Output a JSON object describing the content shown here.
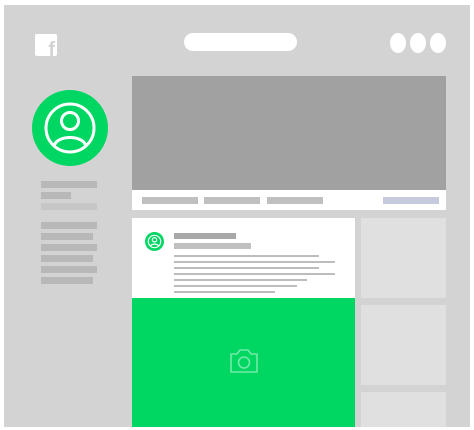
{
  "colors": {
    "frame": "#d3d3d3",
    "accent": "#00d762",
    "cover": "#a1a1a1",
    "placeholder": "#b8b8b8",
    "tile": "#e0e0e0"
  },
  "icons": {
    "brand": "facebook-icon",
    "window_controls": [
      "dot-icon",
      "dot-icon",
      "dot-icon"
    ],
    "profile": "user-icon",
    "media": "camera-icon"
  },
  "browser": {
    "logo_text": "f"
  }
}
